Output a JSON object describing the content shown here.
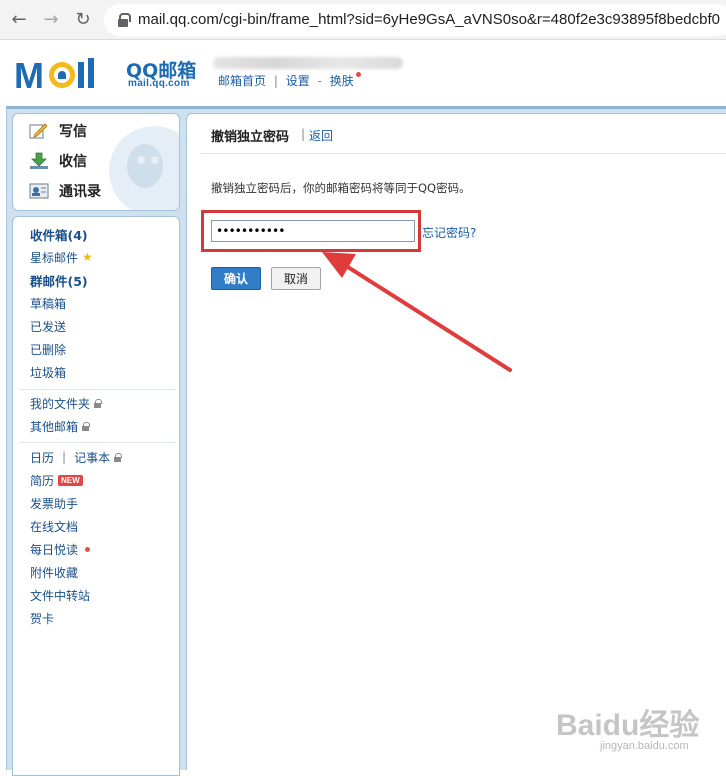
{
  "browser": {
    "url": "mail.qq.com/cgi-bin/frame_html?sid=6yHe9GsA_aVNS0so&r=480f2e3c93895f8bedcbf0"
  },
  "header": {
    "logo_text": "MOil",
    "brand_cn": "QQ邮箱",
    "brand_en": "mail.qq.com",
    "links": [
      "邮箱首页",
      "设置",
      "换肤"
    ],
    "link_separator": "|",
    "link_separator_2": "-"
  },
  "sidebar": {
    "top_items": [
      {
        "label": "写信",
        "icon": "compose-icon"
      },
      {
        "label": "收信",
        "icon": "inbox-download-icon"
      },
      {
        "label": "通讯录",
        "icon": "contacts-icon"
      }
    ],
    "folders": [
      {
        "label": "收件箱(4)",
        "bold": true
      },
      {
        "label": "星标邮件",
        "star": true
      },
      {
        "label": "群邮件(5)",
        "bold": true
      },
      {
        "label": "草稿箱"
      },
      {
        "label": "已发送"
      },
      {
        "label": "已删除"
      },
      {
        "label": "垃圾箱"
      }
    ],
    "my_folders": [
      {
        "label": "我的文件夹",
        "lock": true
      },
      {
        "label": "其他邮箱",
        "lock": true
      }
    ],
    "tools": {
      "calendar": "日历",
      "tools_separator": "|",
      "notes": "记事本",
      "resume": "简历",
      "new_badge": "NEW",
      "invoice": "发票助手",
      "docs": "在线文档",
      "daily": "每日悦读",
      "attachments": "附件收藏",
      "transfer": "文件中转站",
      "cards": "贺卡"
    }
  },
  "main": {
    "title": "撤销独立密码",
    "title_separator": "|",
    "back_link": "返回",
    "description": "撤销独立密码后，你的邮箱密码将等同于QQ密码。",
    "password_value": "•••••••••••",
    "forgot_link": "忘记密码?",
    "confirm_button": "确认",
    "cancel_button": "取消"
  },
  "watermark": {
    "text": "Baidu经验",
    "url": "jingyan.baidu.com"
  },
  "colors": {
    "brand_blue": "#1c6bb3",
    "link_blue": "#1c5ea5",
    "primary_button": "#2f7dc6",
    "highlight_red": "#d23a3a",
    "frame_blue": "#cfe0ee"
  }
}
